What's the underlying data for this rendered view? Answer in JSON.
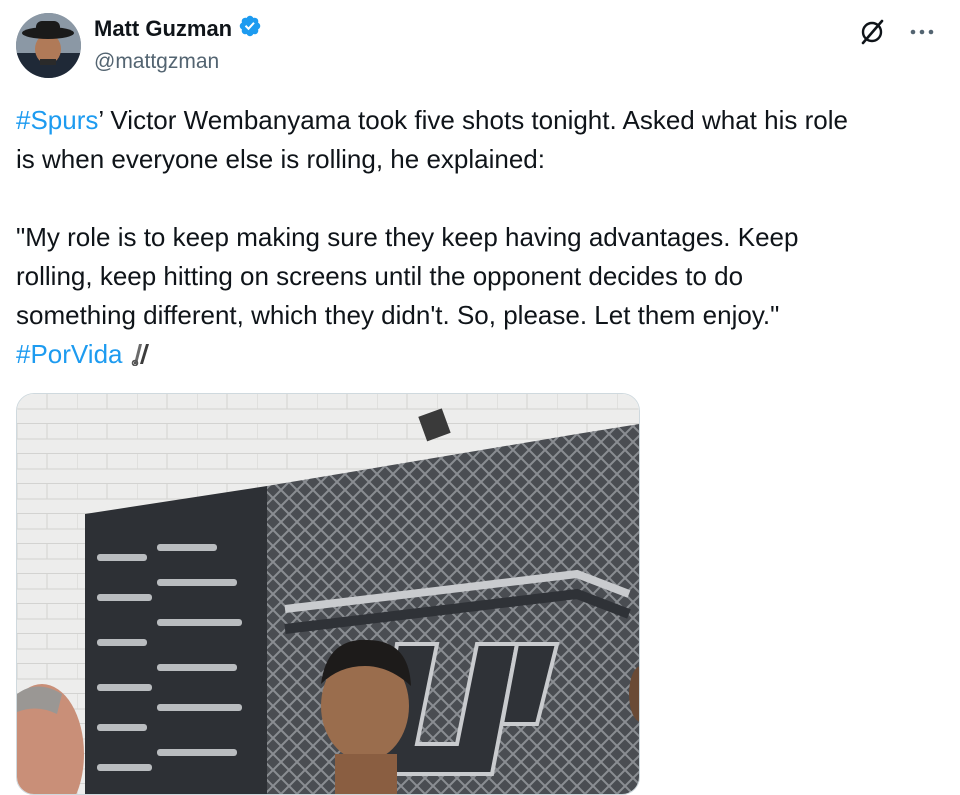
{
  "author": {
    "display_name": "Matt Guzman",
    "handle": "@mattgzman"
  },
  "tweet": {
    "hashtag_spurs": "#Spurs",
    "line1_rest": "’ Victor Wembanyama took five shots tonight. Asked what his role",
    "line2": "is when everyone else is rolling, he explained:",
    "quote": "\"My role is to keep making sure they keep having advantages. Keep\nrolling, keep hitting on screens until the opponent decides to do\nsomething different, which they didn't. So, please. Let them enjoy.\"",
    "hashtag_porvida": "#PorVida"
  },
  "icons": {
    "verified": "verified-badge-icon",
    "grok": "grok-icon",
    "more": "more-icon",
    "spurs_emoji": "spurs-logo-icon"
  },
  "colors": {
    "link": "#1d9bf0",
    "text": "#0f1419",
    "secondary": "#536471"
  }
}
